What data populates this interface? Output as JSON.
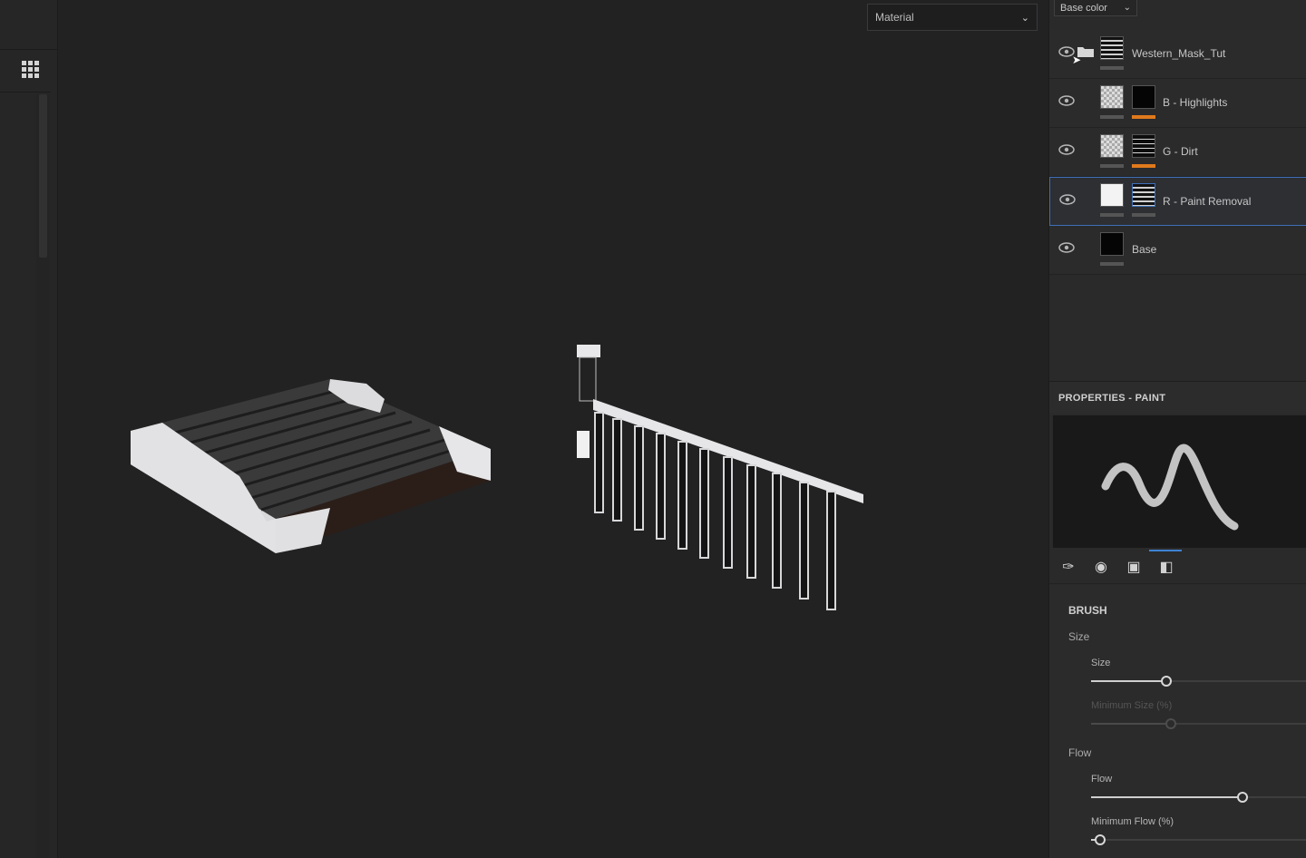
{
  "viewport": {
    "material_select": {
      "value": "Material",
      "chevron_icon": "chevron-down-icon"
    }
  },
  "layers_panel": {
    "channel_select": {
      "value": "Base color"
    },
    "layers": [
      {
        "name": "Western_Mask_Tut",
        "type": "folder",
        "visible": true
      },
      {
        "name": "B - Highlights",
        "visible": true,
        "mask_color": "#e07a1d"
      },
      {
        "name": "G - Dirt",
        "visible": true,
        "mask_color": "#e07a1d"
      },
      {
        "name": "R - Paint Removal",
        "visible": true,
        "selected": true
      },
      {
        "name": "Base",
        "visible": true
      }
    ]
  },
  "properties": {
    "title": "PROPERTIES - PAINT",
    "tabs": [
      "brush-tab",
      "alpha-tab",
      "stencil-tab",
      "material-tab"
    ],
    "brush": {
      "section_title": "BRUSH",
      "size_group": "Size",
      "size_label": "Size",
      "size_value": 0.35,
      "min_size_label": "Minimum Size (%)",
      "min_size_value": 0.37,
      "flow_group": "Flow",
      "flow_label": "Flow",
      "flow_value": 0.7,
      "min_flow_label": "Minimum Flow (%)",
      "min_flow_value": 0.04
    }
  },
  "accent_color": "#3d82d4"
}
